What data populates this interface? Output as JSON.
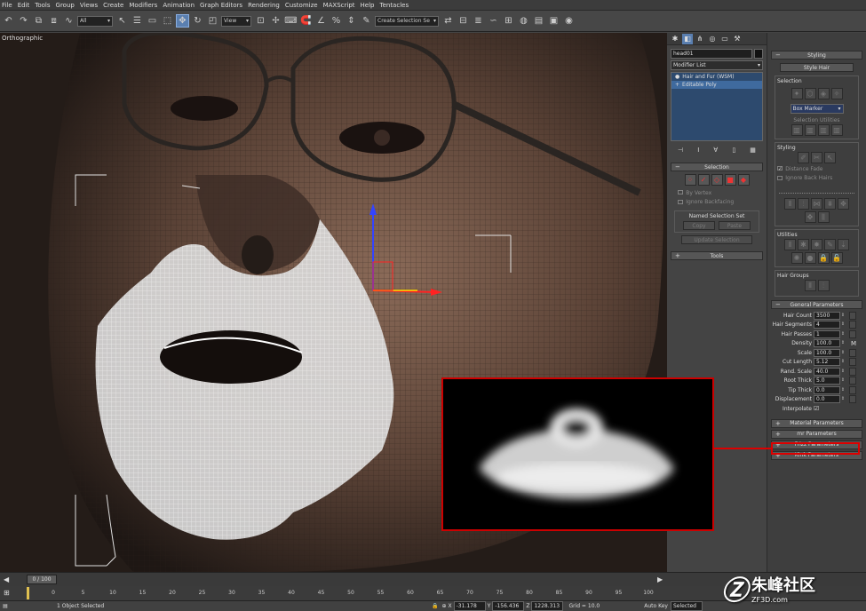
{
  "menu": [
    "File",
    "Edit",
    "Tools",
    "Group",
    "Views",
    "Create",
    "Modifiers",
    "Animation",
    "Graph Editors",
    "Rendering",
    "Customize",
    "MAXScript",
    "Help",
    "Tentacles"
  ],
  "toolbar": {
    "selection_filter": "All",
    "ref_coord": "View",
    "named_selection": "Create Selection Se"
  },
  "viewport": {
    "label": "Orthographic"
  },
  "command_panel": {
    "object_name": "head01",
    "object_color": "#111111",
    "modifier_list": "Modifier List",
    "stack": [
      "Hair and Fur (WSM)",
      "Editable Poly"
    ],
    "selection_rollout": "Selection",
    "by_vertex": "By Vertex",
    "ignore_backfacing": "Ignore Backfacing",
    "named_selection_set": "Named Selection Set",
    "copy": "Copy",
    "paste": "Paste",
    "update_selection": "Update Selection",
    "tools_rollout": "Tools"
  },
  "hair_panel": {
    "styling_rollout": "Styling",
    "style_hair": "Style Hair",
    "selection_label": "Selection",
    "selection_mode": "Box Marker",
    "selection_utilities": "Selection Utilities",
    "styling_label": "Styling",
    "distance_fade": "Distance Fade",
    "ignore_back_hairs": "Ignore Back Hairs",
    "utilities_label": "Utilities",
    "hair_groups_label": "Hair Groups",
    "general_params": "General Parameters",
    "params": [
      {
        "k": "Hair Count",
        "v": "3500"
      },
      {
        "k": "Hair Segments",
        "v": "4"
      },
      {
        "k": "Hair Passes",
        "v": "1"
      },
      {
        "k": "Density",
        "v": "100.0"
      },
      {
        "k": "Scale",
        "v": "100.0"
      },
      {
        "k": "Cut Length",
        "v": "5.12"
      },
      {
        "k": "Rand. Scale",
        "v": "40.0"
      },
      {
        "k": "Root Thick",
        "v": "5.0"
      },
      {
        "k": "Tip Thick",
        "v": "0.0"
      },
      {
        "k": "Displacement",
        "v": "0.0"
      }
    ],
    "density_map_btn": "M",
    "interpolate": "Interpolate",
    "rollouts": [
      "Material Parameters",
      "mr Parameters",
      "Frizz Parameters",
      "Kink Parameters"
    ]
  },
  "timeline": {
    "frame": "0 / 100",
    "ticks": [
      "0",
      "5",
      "10",
      "15",
      "20",
      "25",
      "30",
      "35",
      "40",
      "45",
      "50",
      "55",
      "60",
      "65",
      "70",
      "75",
      "80",
      "85",
      "90",
      "95",
      "100"
    ]
  },
  "status": {
    "selection": "1 Object Selected",
    "x_label": "X",
    "x": "-31.178",
    "y_label": "Y",
    "y": "-156.436",
    "z_label": "Z",
    "z": "1228.313",
    "grid": "Grid = 10.0",
    "auto_key": "Auto Key",
    "key_filter": "Selected"
  },
  "watermark": {
    "text": "朱峰社区",
    "url": "ZF3D.com"
  },
  "colors": {
    "highlight": "#dd0000",
    "stack_bg": "#2d4a6e",
    "accent": "#5a7fb0"
  }
}
